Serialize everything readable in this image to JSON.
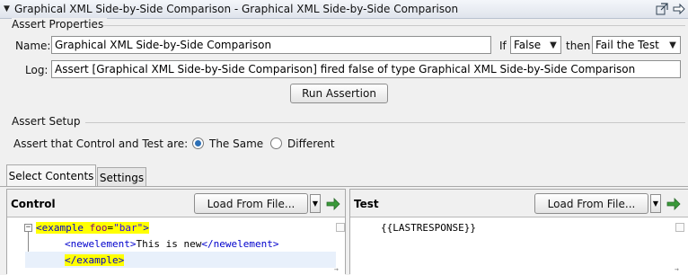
{
  "window": {
    "title": "Graphical XML Side-by-Side Comparison - Graphical XML Side-by-Side Comparison"
  },
  "assert_properties": {
    "group_label": "Assert Properties",
    "name_label": "Name:",
    "name_value": "Graphical XML Side-by-Side Comparison",
    "if_label": "If",
    "if_value": "False",
    "then_label": "then",
    "then_value": "Fail the Test",
    "log_label": "Log:",
    "log_value": "Assert [Graphical XML Side-by-Side Comparison] fired false of type Graphical XML Side-by-Side Comparison",
    "run_button": "Run Assertion"
  },
  "assert_setup": {
    "group_label": "Assert Setup",
    "prompt": "Assert that Control and Test are:",
    "option_same": "The Same",
    "option_different": "Different",
    "selected": "The Same"
  },
  "tabs": [
    {
      "label": "Select Contents",
      "active": true
    },
    {
      "label": "Settings",
      "active": false
    }
  ],
  "control_panel": {
    "title": "Control",
    "load_button": "Load From File...",
    "code": {
      "line1_open": "<example",
      "line1_attr": "foo",
      "line1_eq": "=",
      "line1_val": "\"bar\"",
      "line1_close": ">",
      "line2_open": "<newelement>",
      "line2_text": "This is new",
      "line2_close": "</newelement>",
      "line3": "</example>"
    }
  },
  "test_panel": {
    "title": "Test",
    "load_button": "Load From File...",
    "code_line1": "{{LASTRESPONSE}}"
  },
  "icons": {
    "collapse": "triangle-down-icon",
    "popout": "popout-window-icon",
    "forward": "arrow-right-icon",
    "green_arrow": "green-arrow-right-icon"
  }
}
